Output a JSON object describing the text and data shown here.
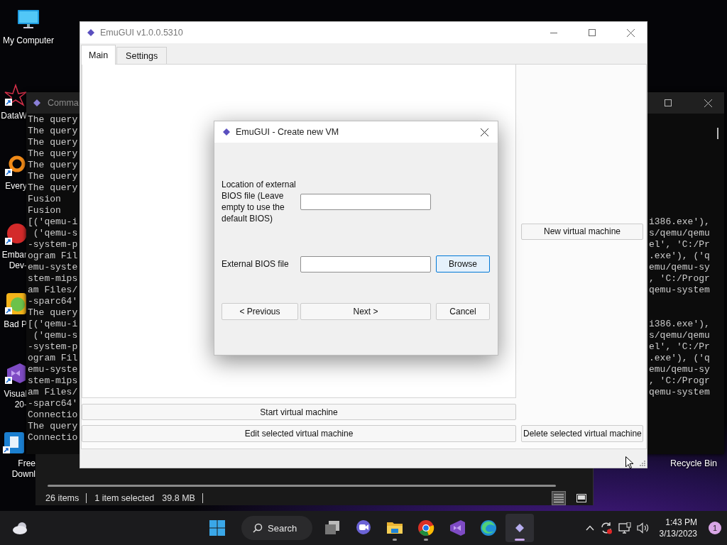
{
  "desktop": {
    "icons": [
      {
        "kind": "computer",
        "label": [
          "My Computer"
        ]
      },
      {
        "kind": "web",
        "label": [
          "DataW"
        ]
      },
      {
        "kind": "ring",
        "label": [
          "Every"
        ]
      },
      {
        "kind": "badge",
        "label": [
          "Embar",
          "Dev-"
        ]
      },
      {
        "kind": "game",
        "label": [
          "Bad P"
        ]
      },
      {
        "kind": "studio",
        "label": [
          "Visual",
          "20-"
        ]
      },
      {
        "kind": "download",
        "label": [
          "Free",
          "Downl"
        ]
      }
    ],
    "recycle_bin": {
      "label": "Recycle Bin"
    }
  },
  "console_window": {
    "title": "Comma",
    "lines": [
      {
        "start": "The query"
      },
      {
        "start": "The query"
      },
      {
        "start": "The query"
      },
      {
        "start": "The query"
      },
      {
        "start": "The query"
      },
      {
        "start": "The query"
      },
      {
        "start": "The query"
      },
      {
        "start": "Fusion"
      },
      {
        "start": "Fusion"
      },
      {
        "start": "[('qemu-i",
        "end": "i386.exe'),"
      },
      {
        "start": " ('qemu-s",
        "end": "s/qemu/qemu"
      },
      {
        "start": "-system-p",
        "end": "el', 'C:/Pr"
      },
      {
        "start": "ogram Fil",
        "end": ".exe'), ('q"
      },
      {
        "start": "emu-syste",
        "end": "emu/qemu-sy"
      },
      {
        "start": "stem-mips",
        "end": ", 'C:/Progr"
      },
      {
        "start": "am Files/",
        "end": "qemu-system"
      },
      {
        "start": "-sparc64'"
      },
      {
        "start": "The query"
      },
      {
        "start": "[('qemu-i",
        "end": "i386.exe'),"
      },
      {
        "start": " ('qemu-s",
        "end": "s/qemu/qemu"
      },
      {
        "start": "-system-p",
        "end": "el', 'C:/Pr"
      },
      {
        "start": "ogram Fil",
        "end": ".exe'), ('q"
      },
      {
        "start": "emu-syste",
        "end": "emu/qemu-sy"
      },
      {
        "start": "stem-mips",
        "end": ", 'C:/Progr"
      },
      {
        "start": "am Files/",
        "end": "qemu-system"
      },
      {
        "start": "-sparc64'"
      },
      {
        "start": "Connectio"
      },
      {
        "start": "The query"
      },
      {
        "start": "Connectio"
      }
    ]
  },
  "explorer_window": {
    "status": [
      "26 items",
      "1 item selected",
      "39.8 MB"
    ],
    "view_buttons": [
      {
        "kind": "details",
        "selected": true
      },
      {
        "kind": "tiles",
        "selected": false
      }
    ]
  },
  "main_window": {
    "title": "EmuGUI v1.0.0.5310",
    "tabs": [
      {
        "label": "Main",
        "selected": true
      },
      {
        "label": "Settings",
        "selected": false
      }
    ],
    "new_vm_button": "New virtual machine",
    "start_button": "Start virtual machine",
    "edit_button": "Edit selected virtual machine",
    "delete_button": "Delete selected virtual machine"
  },
  "dialog": {
    "title": "EmuGUI - Create new VM",
    "bios_location_label": "Location of external BIOS file (Leave empty to use the default BIOS)",
    "bios_file_label": "External BIOS file",
    "browse_button": {
      "label": "Browse",
      "focused": true
    },
    "buttons": [
      "< Previous",
      "Next >",
      "Cancel"
    ]
  },
  "taskbar": {
    "search": "Search",
    "apps": [
      {
        "kind": "taskview",
        "running": false,
        "active": false
      },
      {
        "kind": "chat",
        "running": false,
        "active": false
      },
      {
        "kind": "folder",
        "running": true,
        "active": false
      },
      {
        "kind": "browser",
        "running": true,
        "active": false
      },
      {
        "kind": "studio",
        "running": false,
        "active": false
      },
      {
        "kind": "edge",
        "running": false,
        "active": false
      },
      {
        "kind": "emugui",
        "running": true,
        "active": true
      }
    ],
    "time": "1:43 PM",
    "date": "3/13/2023",
    "notifications": "1"
  }
}
